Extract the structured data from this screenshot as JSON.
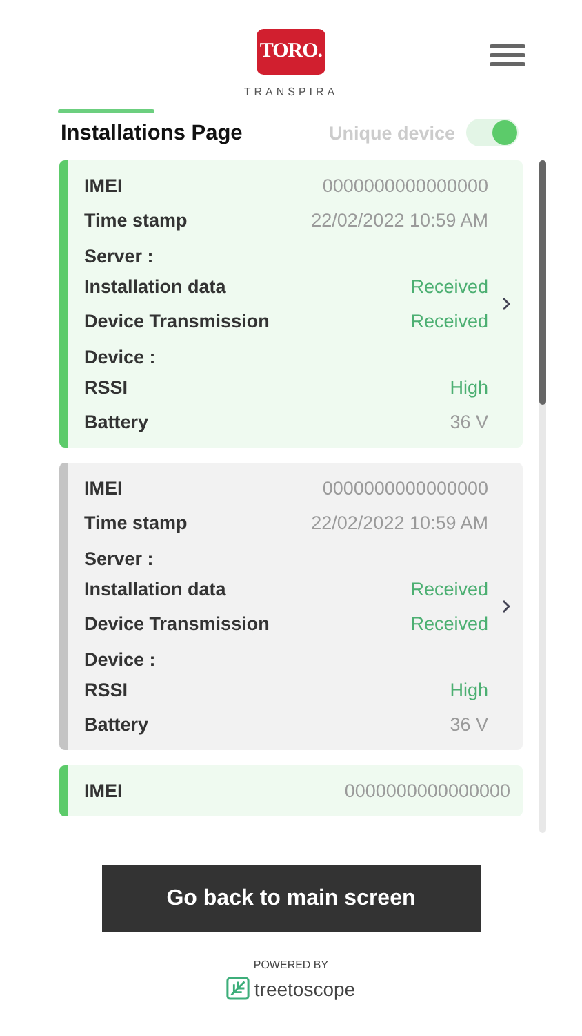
{
  "header": {
    "logo": "TORO.",
    "brand": "TRANSPIRA"
  },
  "page": {
    "title": "Installations Page",
    "tab_selected": true
  },
  "unique_device": {
    "label": "Unique device",
    "on": true
  },
  "cards": [
    {
      "selected": true,
      "sections": [
        {
          "rows": [
            {
              "label": "IMEI",
              "value": "0000000000000000",
              "kind": "plain"
            },
            {
              "label": "Time stamp",
              "value": "22/02/2022 10:59 AM",
              "kind": "plain"
            }
          ]
        },
        {
          "heading": "Server :",
          "rows": [
            {
              "label": "Installation data",
              "value": "Received",
              "kind": "status"
            },
            {
              "label": "Device Transmission",
              "value": "Received",
              "kind": "status"
            }
          ]
        },
        {
          "heading": "Device :",
          "rows": [
            {
              "label": "RSSI",
              "value": "High",
              "kind": "status"
            },
            {
              "label": "Battery",
              "value": "36 V",
              "kind": "plain"
            }
          ]
        }
      ]
    },
    {
      "selected": false,
      "sections": [
        {
          "rows": [
            {
              "label": "IMEI",
              "value": "0000000000000000",
              "kind": "plain"
            },
            {
              "label": "Time stamp",
              "value": "22/02/2022 10:59 AM",
              "kind": "plain"
            }
          ]
        },
        {
          "heading": "Server :",
          "rows": [
            {
              "label": "Installation data",
              "value": "Received",
              "kind": "status"
            },
            {
              "label": "Device Transmission",
              "value": "Received",
              "kind": "status"
            }
          ]
        },
        {
          "heading": "Device :",
          "rows": [
            {
              "label": "RSSI",
              "value": "High",
              "kind": "status"
            },
            {
              "label": "Battery",
              "value": "36 V",
              "kind": "plain"
            }
          ]
        }
      ]
    },
    {
      "selected": true,
      "sections": [
        {
          "rows": [
            {
              "label": "IMEI",
              "value": "0000000000000000",
              "kind": "plain"
            }
          ]
        }
      ]
    }
  ],
  "button": "Go back to main screen",
  "footer": {
    "powered_by": "POWERED BY",
    "brand": "treetoscope"
  }
}
